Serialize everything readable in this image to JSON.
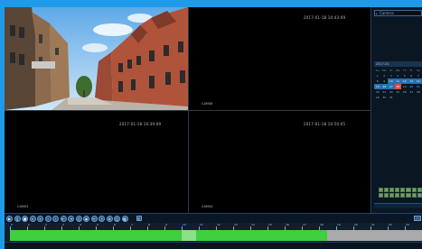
{
  "cameras": [
    {
      "id": "cam1",
      "timestamp": "",
      "name": ""
    },
    {
      "id": "cam2",
      "timestamp": "2017-01-18 10:43:09",
      "name": "CAM08"
    },
    {
      "id": "cam3",
      "timestamp": "2017-01-18 10:39:09",
      "name": "CAM03"
    },
    {
      "id": "cam4",
      "timestamp": "2017-01-18 10:50:05",
      "name": "CAM04"
    }
  ],
  "panel": {
    "camera_select": "Camera",
    "month": "2017-01",
    "weekdays": [
      "Su",
      "Mo",
      "Tu",
      "We",
      "Th",
      "Fr",
      "Sa"
    ],
    "weeks": [
      [
        "1",
        "2",
        "3",
        "4",
        "5",
        "6",
        "7"
      ],
      [
        "8",
        "9",
        "10",
        "11",
        "12",
        "13",
        "14"
      ],
      [
        "15",
        "16",
        "17",
        "18",
        "19",
        "20",
        "21"
      ],
      [
        "22",
        "23",
        "24",
        "25",
        "26",
        "27",
        "28"
      ],
      [
        "29",
        "30",
        "31",
        "",
        "",
        "",
        ""
      ]
    ],
    "selected_day": "18",
    "record_days": [
      "10",
      "11",
      "12",
      "13",
      "14",
      "15",
      "16",
      "17",
      "18"
    ]
  },
  "timeline": {
    "hours": [
      "0",
      "1",
      "2",
      "3",
      "4",
      "5",
      "6",
      "7",
      "8",
      "9",
      "10",
      "11",
      "12",
      "13",
      "14",
      "15",
      "16",
      "17",
      "18",
      "19",
      "20",
      "21",
      "22",
      "23"
    ],
    "recorded_fraction": 0.77
  },
  "colors": {
    "frame": "#1e9be8",
    "record": "#3fcf3f",
    "empty": "#a9a9a9",
    "selected_day": "#e24b3a"
  }
}
